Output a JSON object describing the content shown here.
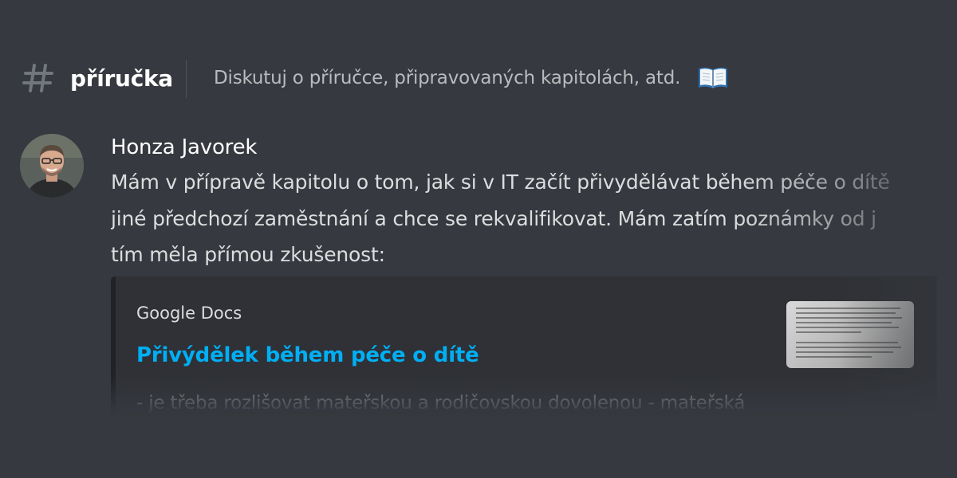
{
  "channel": {
    "name": "příručka",
    "topic": "Diskutuj o příručce, připravovaných kapitolách, atd."
  },
  "icons": {
    "channel": "hash-icon",
    "topic_emoji": "open-book-icon"
  },
  "message": {
    "author": "Honza Javorek",
    "lines": [
      "Mám v přípravě kapitolu o tom, jak si v IT začít přivydělávat během péče o dítě",
      "jiné předchozí zaměstnání a chce se rekvalifikovat. Mám zatím poznámky od j",
      "tím měla přímou zkušenost:"
    ]
  },
  "embed": {
    "provider": "Google Docs",
    "title": "Přivýdělek během péče o dítě",
    "description": "- je třeba rozlišovat mateřskou a rodičovskou dovolenou - mateřská"
  },
  "colors": {
    "background": "#36393f",
    "embed_background": "#2f3136",
    "link": "#00aff4",
    "text": "#dcddde",
    "muted": "#b9bbbe"
  }
}
